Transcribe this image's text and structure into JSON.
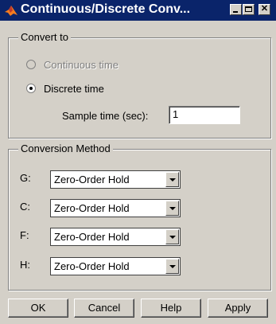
{
  "window": {
    "title": "Continuous/Discrete Conv..."
  },
  "convert_to": {
    "legend": "Convert to",
    "continuous_label": "Continuous time",
    "discrete_label": "Discrete time",
    "selected": "discrete",
    "sample_time_label": "Sample time (sec):",
    "sample_time_value": "1"
  },
  "conversion_method": {
    "legend": "Conversion Method",
    "rows": [
      {
        "label": "G:",
        "value": "Zero-Order Hold"
      },
      {
        "label": "C:",
        "value": "Zero-Order Hold"
      },
      {
        "label": "F:",
        "value": "Zero-Order Hold"
      },
      {
        "label": "H:",
        "value": "Zero-Order Hold"
      }
    ]
  },
  "buttons": {
    "ok": "OK",
    "cancel": "Cancel",
    "help": "Help",
    "apply": "Apply"
  },
  "icons": {
    "app": "matlab-icon",
    "minimize": "minimize-icon",
    "maximize": "maximize-icon",
    "close": "close-icon",
    "dropdown": "chevron-down-icon"
  }
}
